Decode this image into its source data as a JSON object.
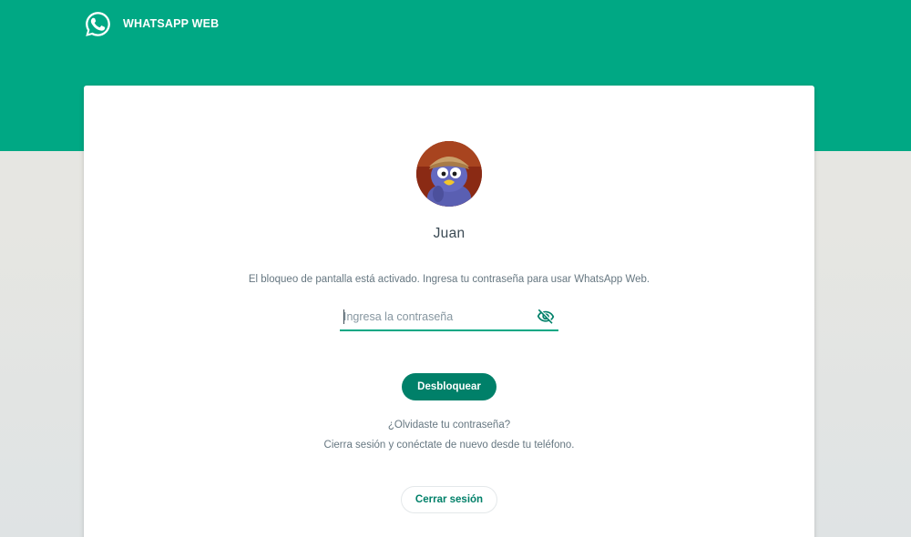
{
  "header": {
    "title": "WHATSAPP WEB",
    "logo_icon": "whatsapp-logo-icon",
    "background_color": "#00a884"
  },
  "lock_screen": {
    "avatar_icon": "profile-avatar",
    "user_name": "Juan",
    "message": "El bloqueo de pantalla está activado. Ingresa tu contraseña para usar WhatsApp Web.",
    "password_placeholder": "Ingresa la contraseña",
    "password_value": "",
    "visibility_toggle_icon": "eye-off-icon",
    "unlock_button_label": "Desbloquear",
    "forgot_password_link": "¿Olvidaste tu contraseña?",
    "forgot_password_hint": "Cierra sesión y conéctate de nuevo desde tu teléfono.",
    "logout_button_label": "Cerrar sesión"
  },
  "colors": {
    "accent": "#00a884",
    "button": "#008069",
    "text_secondary": "#667781"
  }
}
